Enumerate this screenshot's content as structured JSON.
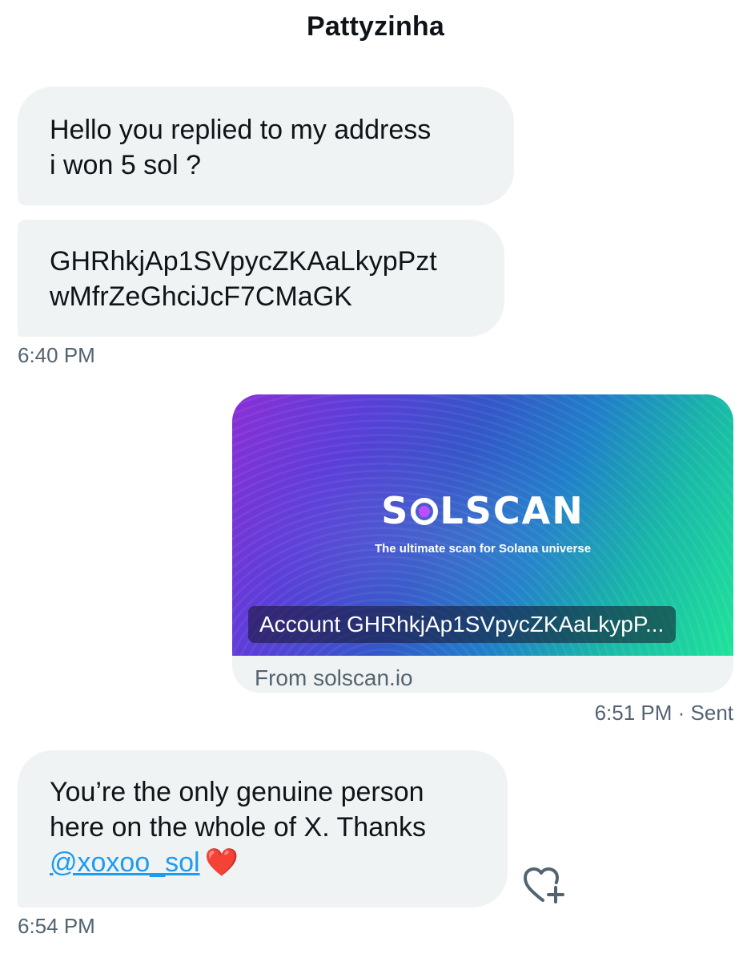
{
  "header": {
    "title": "Pattyzinha"
  },
  "messages": {
    "m1": {
      "line1": "Hello you replied to my address",
      "line2": "i won 5 sol ?"
    },
    "m2": {
      "line1": "GHRhkjAp1SVpycZKAaLkypPzt",
      "line2": "wMfrZeGhciJcF7CMaGK"
    },
    "time1": "6:40 PM",
    "card": {
      "brand_left": "S",
      "brand_right": "LSCAN",
      "tagline": "The ultimate scan for Solana universe",
      "account": "Account GHRhkjAp1SVpycZKAaLkypP...",
      "source": "From solscan.io"
    },
    "time2": "6:51 PM · Sent",
    "m3": {
      "line1": "You’re the only genuine person",
      "line2": "here on the whole of X. Thanks",
      "mention": "@xoxoo_sol",
      "emoji": "❤️"
    },
    "time3": "6:54 PM"
  },
  "colors": {
    "mention": "#1d9bf0",
    "bubble": "#eff3f4",
    "muted": "#536471"
  },
  "icons": {
    "react": "heart-plus-icon"
  }
}
